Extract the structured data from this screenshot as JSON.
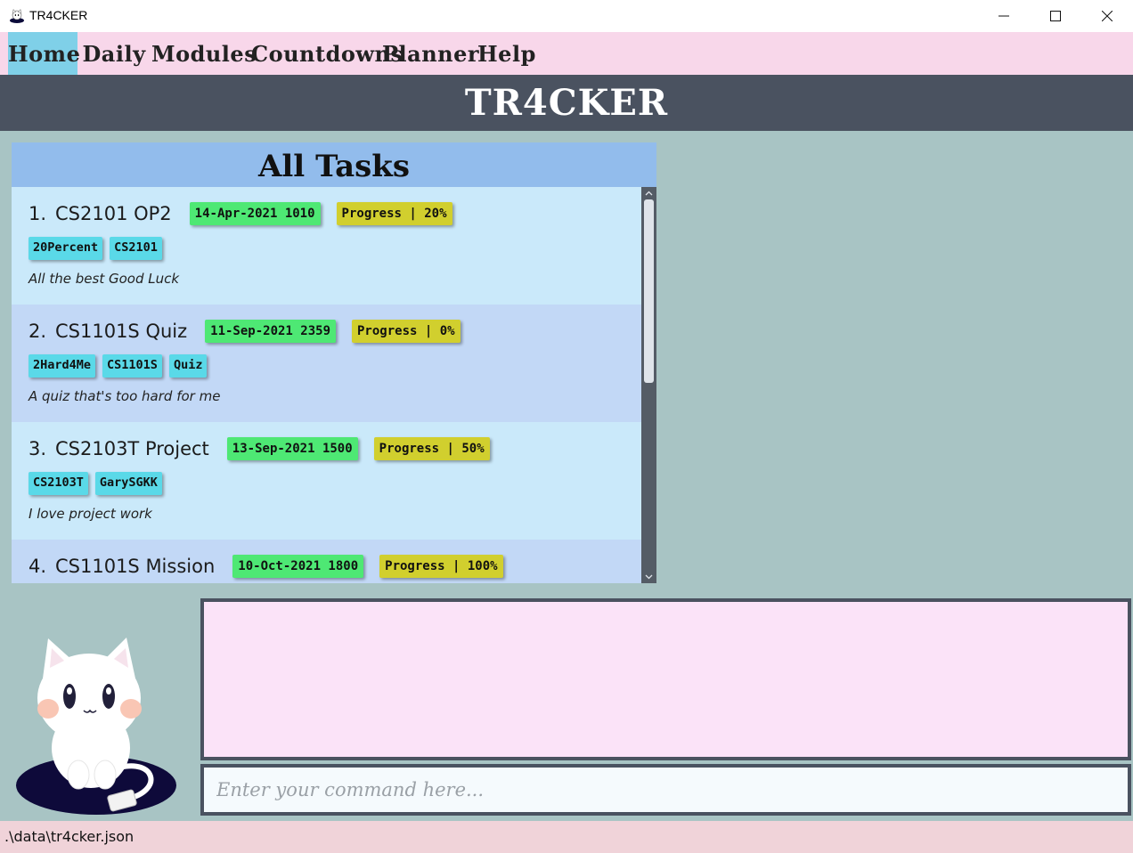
{
  "window": {
    "title": "TR4CKER",
    "controls": [
      "minimize-icon",
      "maximize-icon",
      "close-icon"
    ]
  },
  "menu": {
    "items": [
      {
        "label": "Home",
        "active": true
      },
      {
        "label": "Daily",
        "active": false
      },
      {
        "label": "Modules",
        "active": false
      },
      {
        "label": "Countdowns",
        "active": false
      },
      {
        "label": "Planner",
        "active": false
      },
      {
        "label": "Help",
        "active": false
      }
    ]
  },
  "header": {
    "title": "TR4CKER"
  },
  "tasks_panel": {
    "title": "All Tasks",
    "tasks": [
      {
        "index": "1.",
        "name": "CS2101 OP2",
        "deadline": "14-Apr-2021 1010",
        "progress": "Progress | 20%",
        "tags": [
          "20Percent",
          "CS2101"
        ],
        "description": "All the best Good Luck"
      },
      {
        "index": "2.",
        "name": "CS1101S Quiz",
        "deadline": "11-Sep-2021 2359",
        "progress": "Progress | 0%",
        "tags": [
          "2Hard4Me",
          "CS1101S",
          "Quiz"
        ],
        "description": "A quiz that's too hard for me"
      },
      {
        "index": "3.",
        "name": "CS2103T Project",
        "deadline": "13-Sep-2021 1500",
        "progress": "Progress | 50%",
        "tags": [
          "CS2103T",
          "GarySGKK"
        ],
        "description": "I love project work"
      },
      {
        "index": "4.",
        "name": "CS1101S Mission",
        "deadline": "10-Oct-2021 1800",
        "progress": "Progress | 100%",
        "tags": [],
        "description": ""
      }
    ]
  },
  "result_display": {
    "text": ""
  },
  "command_box": {
    "placeholder": "Enter your command here...",
    "value": ""
  },
  "status_bar": {
    "path": ".\\data\\tr4cker.json"
  },
  "colors": {
    "menu_bg": "#f8d7ea",
    "menu_active": "#7fd0e8",
    "header_bg": "#4a5260",
    "background": "#a8c4c4",
    "deadline_chip": "#4ee874",
    "progress_chip": "#d1cf2e",
    "tag_chip": "#5ad9e8"
  },
  "mascot": {
    "icon": "cat-mascot-icon"
  }
}
